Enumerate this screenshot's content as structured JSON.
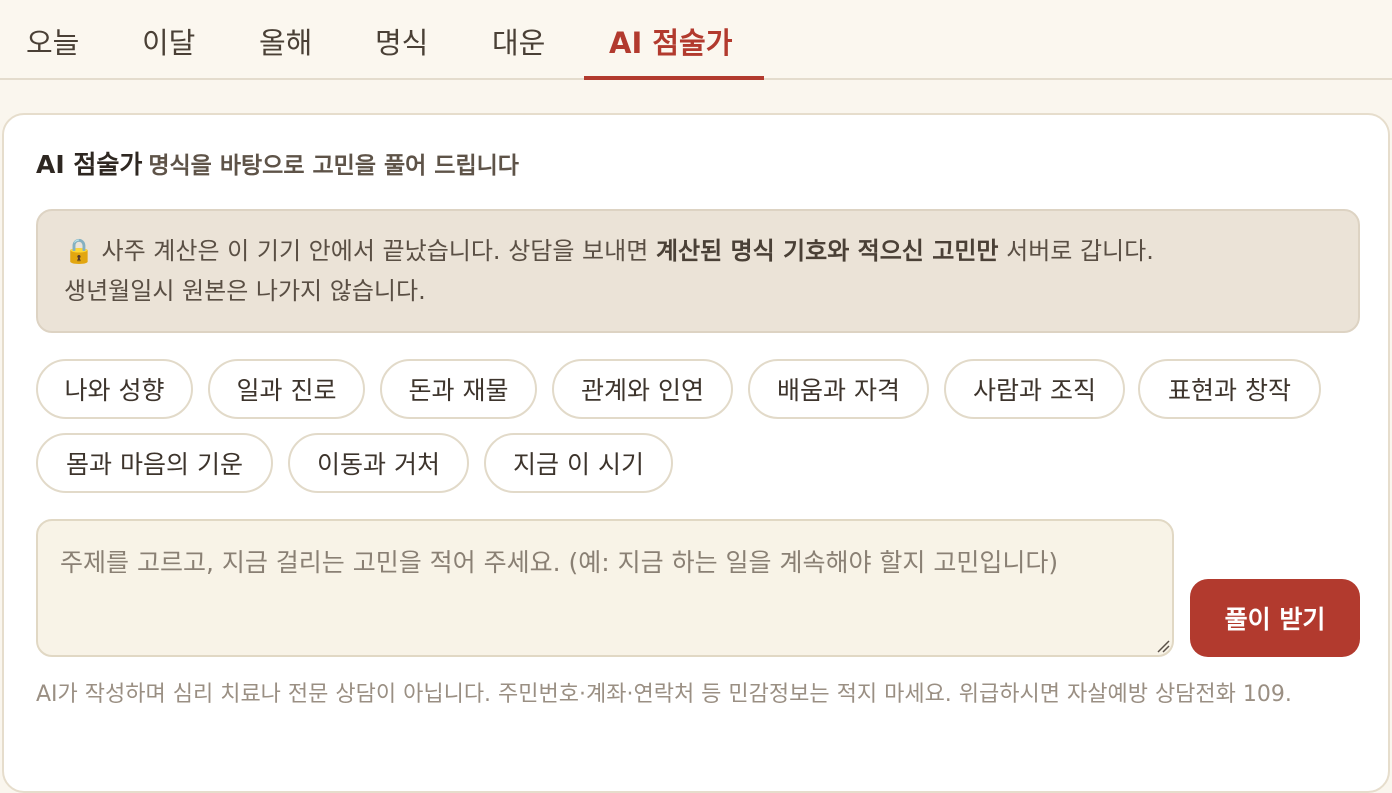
{
  "tabs": {
    "today": "오늘",
    "month": "이달",
    "year": "올해",
    "chart": "명식",
    "luck": "대운",
    "ai": "AI 점술가"
  },
  "card": {
    "title": "AI 점술가",
    "subtitle": "명식을 바탕으로 고민을 풀어 드립니다"
  },
  "notice": {
    "icon": "lock-icon",
    "text_before": "🔒 사주 계산은 이 기기 안에서 끝났습니다. 상담을 보내면 ",
    "text_bold": "계산된 명식 기호와 적으신 고민만",
    "text_after": " 서버로 갑니다.",
    "line2": "생년월일시 원본은 나가지 않습니다."
  },
  "topics": [
    "나와 성향",
    "일과 진로",
    "돈과 재물",
    "관계와 인연",
    "배움과 자격",
    "사람과 조직",
    "표현과 창작",
    "몸과 마음의 기운",
    "이동과 거처",
    "지금 이 시기"
  ],
  "input": {
    "placeholder": "주제를 고르고, 지금 걸리는 고민을 적어 주세요. (예: 지금 하는 일을 계속해야 할지 고민입니다)"
  },
  "submit_label": "풀이 받기",
  "disclaimer": "AI가 작성하며 심리 치료나 전문 상담이 아닙니다. 주민번호·계좌·연락처 등 민감정보는 적지 마세요. 위급하시면 자살예방 상담전화 109.",
  "colors": {
    "accent": "#b23a2e",
    "background": "#faf6ee",
    "notice_bg": "#ebe3d7"
  }
}
